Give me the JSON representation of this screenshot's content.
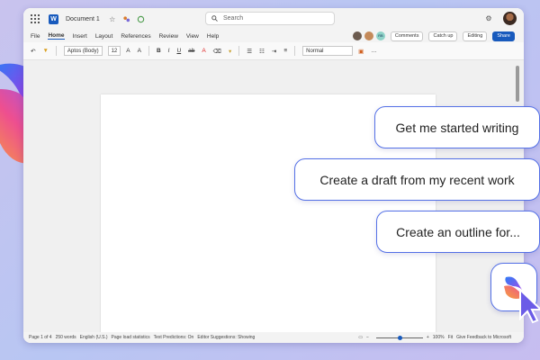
{
  "titlebar": {
    "doc_title": "Document 1",
    "search_placeholder": "Search"
  },
  "menubar": {
    "tabs": [
      "File",
      "Home",
      "Insert",
      "Layout",
      "References",
      "Review",
      "View",
      "Help"
    ],
    "active_tab": "Home",
    "presence_initials": "RB",
    "comments_label": "Comments",
    "catchup_label": "Catch up",
    "editing_label": "Editing",
    "share_label": "Share"
  },
  "ribbon": {
    "font_name": "Aptos (Body)",
    "font_size": "12",
    "style_name": "Normal"
  },
  "statusbar": {
    "page": "Page 1 of 4",
    "words": "250 words",
    "language": "English (U.S.)",
    "page_load": "Page load statistics",
    "text_predictions": "Text Predictions: On",
    "editor": "Editor Suggestions: Showing",
    "zoom": "100%",
    "fit": "Fit",
    "feedback": "Give Feedback to Microsoft"
  },
  "prompts": {
    "p1": "Get me started writing",
    "p2": "Create a draft from my recent work",
    "p3": "Create an outline for..."
  },
  "colors": {
    "accent": "#185abd",
    "bubble_border": "#5470e6",
    "background": "#c9c3ee"
  },
  "icons": {
    "app": "word-logo-icon",
    "search": "search-icon",
    "copilot": "copilot-icon",
    "settings": "gear-icon"
  }
}
